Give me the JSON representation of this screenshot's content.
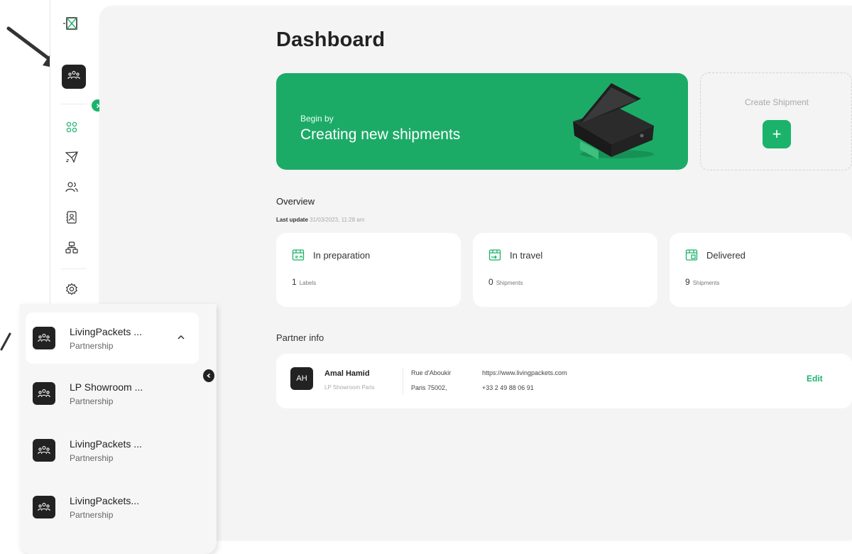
{
  "dashboard": {
    "title": "Dashboard"
  },
  "hero": {
    "small": "Begin by",
    "big": "Creating new shipments"
  },
  "create_shipment": {
    "label": "Create Shipment",
    "plus": "+"
  },
  "overview": {
    "title": "Overview",
    "last_update_label": "Last update",
    "last_update_value": "31/03/2023, 11:28 am",
    "stats": [
      {
        "label": "In preparation",
        "count": "1",
        "unit": "Labels"
      },
      {
        "label": "In travel",
        "count": "0",
        "unit": "Shipments"
      },
      {
        "label": "Delivered",
        "count": "9",
        "unit": "Shipments"
      }
    ]
  },
  "partner_info": {
    "title": "Partner info",
    "avatar": "AH",
    "name": "Amal Hamid",
    "company": "LP Showroom Paris",
    "address_line1": "Rue d'Aboukir",
    "address_line2": "Paris 75002,",
    "website": "https://www.livingpackets.com",
    "phone": "+33 2 49 88 06 91",
    "edit": "Edit"
  },
  "dropdown": {
    "items": [
      {
        "name": "LivingPackets ...",
        "type": "Partnership"
      },
      {
        "name": "LP Showroom ...",
        "type": "Partnership"
      },
      {
        "name": "LivingPackets ...",
        "type": "Partnership"
      },
      {
        "name": "LivingPackets...",
        "type": "Partnership"
      }
    ]
  },
  "colors": {
    "accent": "#1bb36b",
    "hero": "#1cab67",
    "dark": "#222222",
    "background": "#f4f4f4"
  },
  "icons": {
    "logo": "box-logo-icon",
    "partner": "partnership-icon",
    "nav": [
      "dashboard-grid-icon",
      "send-icon",
      "users-icon",
      "contacts-icon",
      "network-icon",
      "gear-icon"
    ],
    "stats": "box-status-icon"
  }
}
